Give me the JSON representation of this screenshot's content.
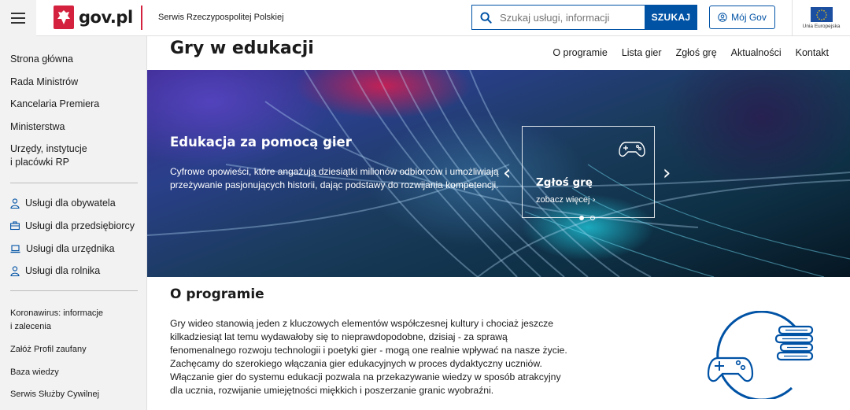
{
  "header": {
    "logo_text": "gov.pl",
    "service_name": "Serwis Rzeczypospolitej Polskiej",
    "search_placeholder": "Szukaj usługi, informacji",
    "search_button": "SZUKAJ",
    "account_button": "Mój Gov",
    "eu_label": "Unia Europejska"
  },
  "sidebar": {
    "main_items": [
      "Strona główna",
      "Rada Ministrów",
      "Kancelaria Premiera",
      "Ministerstwa",
      "Urzędy, instytucje",
      "i placówki RP"
    ],
    "service_items": [
      "Usługi dla obywatela",
      "Usługi dla przedsiębiorcy",
      "Usługi dla urzędnika",
      "Usługi dla rolnika"
    ],
    "extra_items": [
      "Koronawirus: informacje",
      "i zalecenia",
      "Załóż Profil zaufany",
      "Baza wiedzy",
      "Serwis Służby Cywilnej"
    ]
  },
  "page": {
    "title": "Gry w edukacji",
    "nav": [
      "O programie",
      "Lista gier",
      "Zgłoś grę",
      "Aktualności",
      "Kontakt"
    ]
  },
  "hero": {
    "title": "Edukacja za pomocą gier",
    "description": "Cyfrowe opowieści, które angażują dziesiątki milionów odbiorców i umożliwiają przeżywanie pasjonujących historii, dając podstawy do rozwijania kompetencji.",
    "card_title": "Zgłoś grę",
    "card_link": "zobacz więcej",
    "slides_total": 2,
    "slide_active": 1
  },
  "section": {
    "title": "O programie",
    "text": "Gry wideo stanowią jeden z kluczowych elementów współczesnej kultury i chociaż jeszcze kilkadziesiąt lat temu wydawałoby się to nieprawdopodobne, dzisiaj - za sprawą fenomenalnego rozwoju technologii i poetyki gier - mogą one realnie wpływać na nasze życie. Zachęcamy do szerokiego włączania gier edukacyjnych w proces dydaktyczny uczniów. Włączanie gier do systemu edukacji pozwala na przekazywanie wiedzy w sposób atrakcyjny dla ucznia, rozwijanie umiejętności miękkich i poszerzanie granic wyobraźni."
  },
  "colors": {
    "primary": "#0052a5",
    "brand_red": "#d4213d",
    "sidebar_bg": "#f2f2f2"
  }
}
